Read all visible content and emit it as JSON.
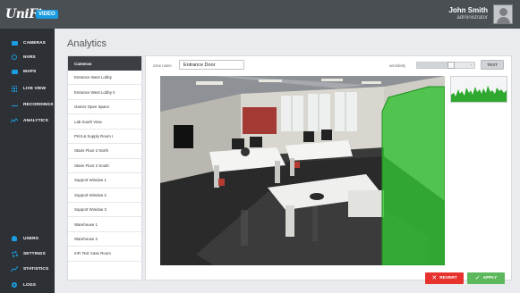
{
  "app": {
    "logo_text": "UniFi",
    "logo_badge": "VIDEO"
  },
  "user": {
    "name": "John Smith",
    "role": "administrator"
  },
  "nav": {
    "top": [
      {
        "label": "CAMERAS",
        "icon": "camera-icon"
      },
      {
        "label": "NVRS",
        "icon": "nvr-icon"
      },
      {
        "label": "MAPS",
        "icon": "map-icon"
      },
      {
        "label": "LIVE VIEW",
        "icon": "grid-icon"
      },
      {
        "label": "RECORDINGS",
        "icon": "recordings-icon"
      },
      {
        "label": "ANALYTICS",
        "icon": "analytics-icon"
      }
    ],
    "bottom": [
      {
        "label": "USERS",
        "icon": "users-icon"
      },
      {
        "label": "SETTINGS",
        "icon": "gear-icon"
      },
      {
        "label": "STATISTICS",
        "icon": "statistics-icon"
      },
      {
        "label": "LOGS",
        "icon": "logs-icon"
      }
    ]
  },
  "page": {
    "title": "Analytics"
  },
  "camera_list": {
    "header": "Cameras",
    "selected_index": 0,
    "items": [
      "Entrance West Lobby",
      "Entrance West Lobby II",
      "Gamer Open Space",
      "Lab South View",
      "Print & Supply Room I",
      "Stairs Floor 2 North",
      "Stairs Floor 2 South",
      "Support Window 1",
      "Support Window 2",
      "Support Window 3",
      "Warehouse 1",
      "Warehouse 2",
      "mFi Test Case Room"
    ]
  },
  "zone": {
    "label": "zone name",
    "value": "Entrance Door"
  },
  "sensitivity": {
    "label": "sensitivity",
    "level": 0.6,
    "max_symbol": "+"
  },
  "buttons": {
    "test": "TEST",
    "revert": "REVERT",
    "apply": "APPLY"
  },
  "colors": {
    "accent": "#1a9ce0",
    "zone_overlay": "#33c233",
    "revert": "#e7322d",
    "apply": "#5cb85c"
  }
}
